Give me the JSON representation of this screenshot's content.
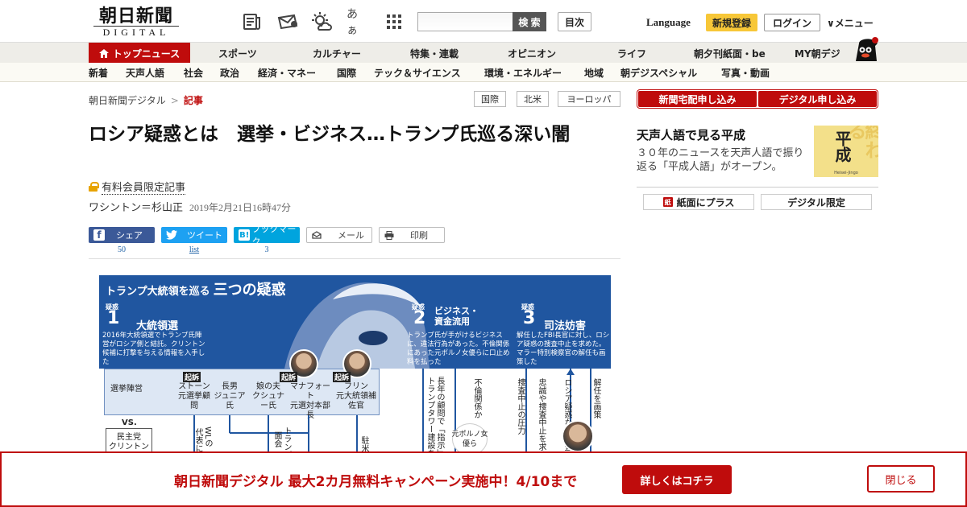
{
  "header": {
    "logo_main": "朝日新聞",
    "logo_sub": "DIGITAL",
    "icons": [
      "newspaper-icon",
      "message-icon",
      "weather-icon",
      "font-size-icon",
      "apps-grid-icon"
    ],
    "font_size_label": "あぁ",
    "search_placeholder": "",
    "search_button": "検 索",
    "toc_button": "目次",
    "language": "Language",
    "signup": "新規登録",
    "login": "ログイン",
    "menu": "メニュー"
  },
  "mainnav": {
    "top": "トップニュース",
    "items": [
      "スポーツ",
      "カルチャー",
      "特集・連載",
      "オピニオン",
      "ライフ",
      "朝夕刊紙面・be",
      "MY朝デジ"
    ]
  },
  "subnav": {
    "items": [
      "新着",
      "天声人語",
      "社会",
      "政治",
      "経済・マネー",
      "国際",
      "テック＆サイエンス",
      "環境・エネルギー",
      "地域",
      "朝デジスペシャル",
      "写真・動画"
    ]
  },
  "breadcrumb": {
    "home": "朝日新聞デジタル",
    "separator": ">",
    "current": "記事"
  },
  "tags": [
    "国際",
    "北米",
    "ヨーロッパ"
  ],
  "article": {
    "title": "ロシア疑惑とは　選挙・ビジネス…トランプ氏巡る深い闇",
    "paid_label": "有料会員限定記事",
    "author": "ワシントン＝杉山正",
    "date": "2019年2月21日16時47分"
  },
  "share": {
    "facebook": "シェア",
    "facebook_count": "50",
    "twitter": "ツイート",
    "twitter_count": "list",
    "hatena": "ブックマーク",
    "hatena_count": "3",
    "mail": "メール",
    "print": "印刷"
  },
  "infographic": {
    "title_prefix": "トランプ大統領を巡る",
    "title_main": "三つの疑惑",
    "sections": [
      {
        "label": "疑惑",
        "num": "1",
        "title": "大統領選",
        "desc": "2016年大統領選でトランプ氏陣営がロシア側と結託。クリントン候補に打撃を与える情報を入手した"
      },
      {
        "label": "疑惑",
        "num": "2",
        "title": "ビジネス・資金流用",
        "desc": "トランプ氏が手がけるビジネスに、違法行為があった。不倫関係にあった元ポルノ女優らに口止め料を払った"
      },
      {
        "label": "疑惑",
        "num": "3",
        "title": "司法妨害",
        "desc": "解任したFBI長官に対し、ロシア疑惑の捜査中止を求めた。マラー特別検察官の解任も画策した"
      }
    ],
    "camp": "選挙陣営",
    "vs": "VS.",
    "democrats": "民主党",
    "democrats_sub": "クリントン氏",
    "indicted": "起訴",
    "people": [
      {
        "name": "ストーン",
        "role": "元選挙顧問",
        "indicted": true
      },
      {
        "name": "長男",
        "role": "ジュニア氏",
        "indicted": false
      },
      {
        "name": "娘の夫",
        "role": "クシュナー氏",
        "indicted": false
      },
      {
        "name": "マナフォート",
        "role": "元選対本部長",
        "indicted": true
      },
      {
        "name": "フリン",
        "role": "元大統領補佐官",
        "indicted": true
      }
    ],
    "vertical": [
      "WLの",
      "代表に",
      "面会",
      "トランプ",
      "駐米ロ",
      "長年の顧問で「指示」",
      "トランプタワー建設を",
      "不倫関係か",
      "元ポルノ女優ら",
      "捜査中止の圧力",
      "忠誠や捜査中止を求め",
      "ロシア疑惑など捜査",
      "解任を画策"
    ]
  },
  "sidebar": {
    "subscribe_paper": "新聞宅配申し込み",
    "subscribe_digital": "デジタル申し込み",
    "tensei_title": "天声人語で見る平成",
    "tensei_desc": "３０年のニュースを天声人語で振り返る「平成人語」がオープン。",
    "heisei_bg": "終わる",
    "heisei_kanji": "平成",
    "heisei_caption": "Heisei-Jingo",
    "paper_plus": "紙面にプラス",
    "paper_plus_icon": "紙",
    "digital_only": "デジタル限定"
  },
  "banner": {
    "text": "朝日新聞デジタル 最大2カ月無料キャンペーン実施中！4/10まで",
    "cta": "詳しくはコチラ",
    "close": "閉じる"
  },
  "colors": {
    "brand_red": "#bf0c0c",
    "signup_yellow": "#f7c738",
    "facebook": "#3b5998",
    "twitter": "#1da1f2",
    "hatena": "#00a4de",
    "infographic_blue": "#2056a0"
  }
}
